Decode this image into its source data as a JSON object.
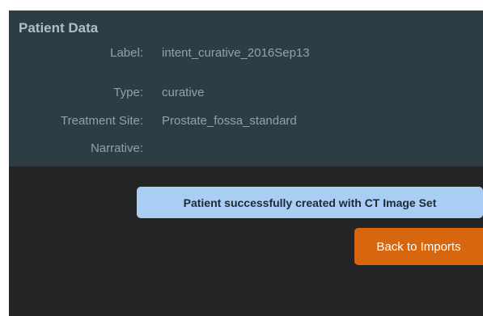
{
  "patient_panel": {
    "title": "Patient Data",
    "fields": [
      {
        "label": "Label:",
        "value": "intent_curative_2016Sep13"
      },
      {
        "label": "Type:",
        "value": "curative"
      },
      {
        "label": "Treatment Site:",
        "value": "Prostate_fossa_standard"
      },
      {
        "label": "Narrative:",
        "value": ""
      }
    ]
  },
  "status": {
    "message": "Patient successfully created with CT Image Set"
  },
  "actions": {
    "back_label": "Back to Imports"
  },
  "colors": {
    "panel_bg": "#2c3d44",
    "page_bg": "#232425",
    "message_bg": "#a9cdf3",
    "button_bg": "#d8660f"
  }
}
